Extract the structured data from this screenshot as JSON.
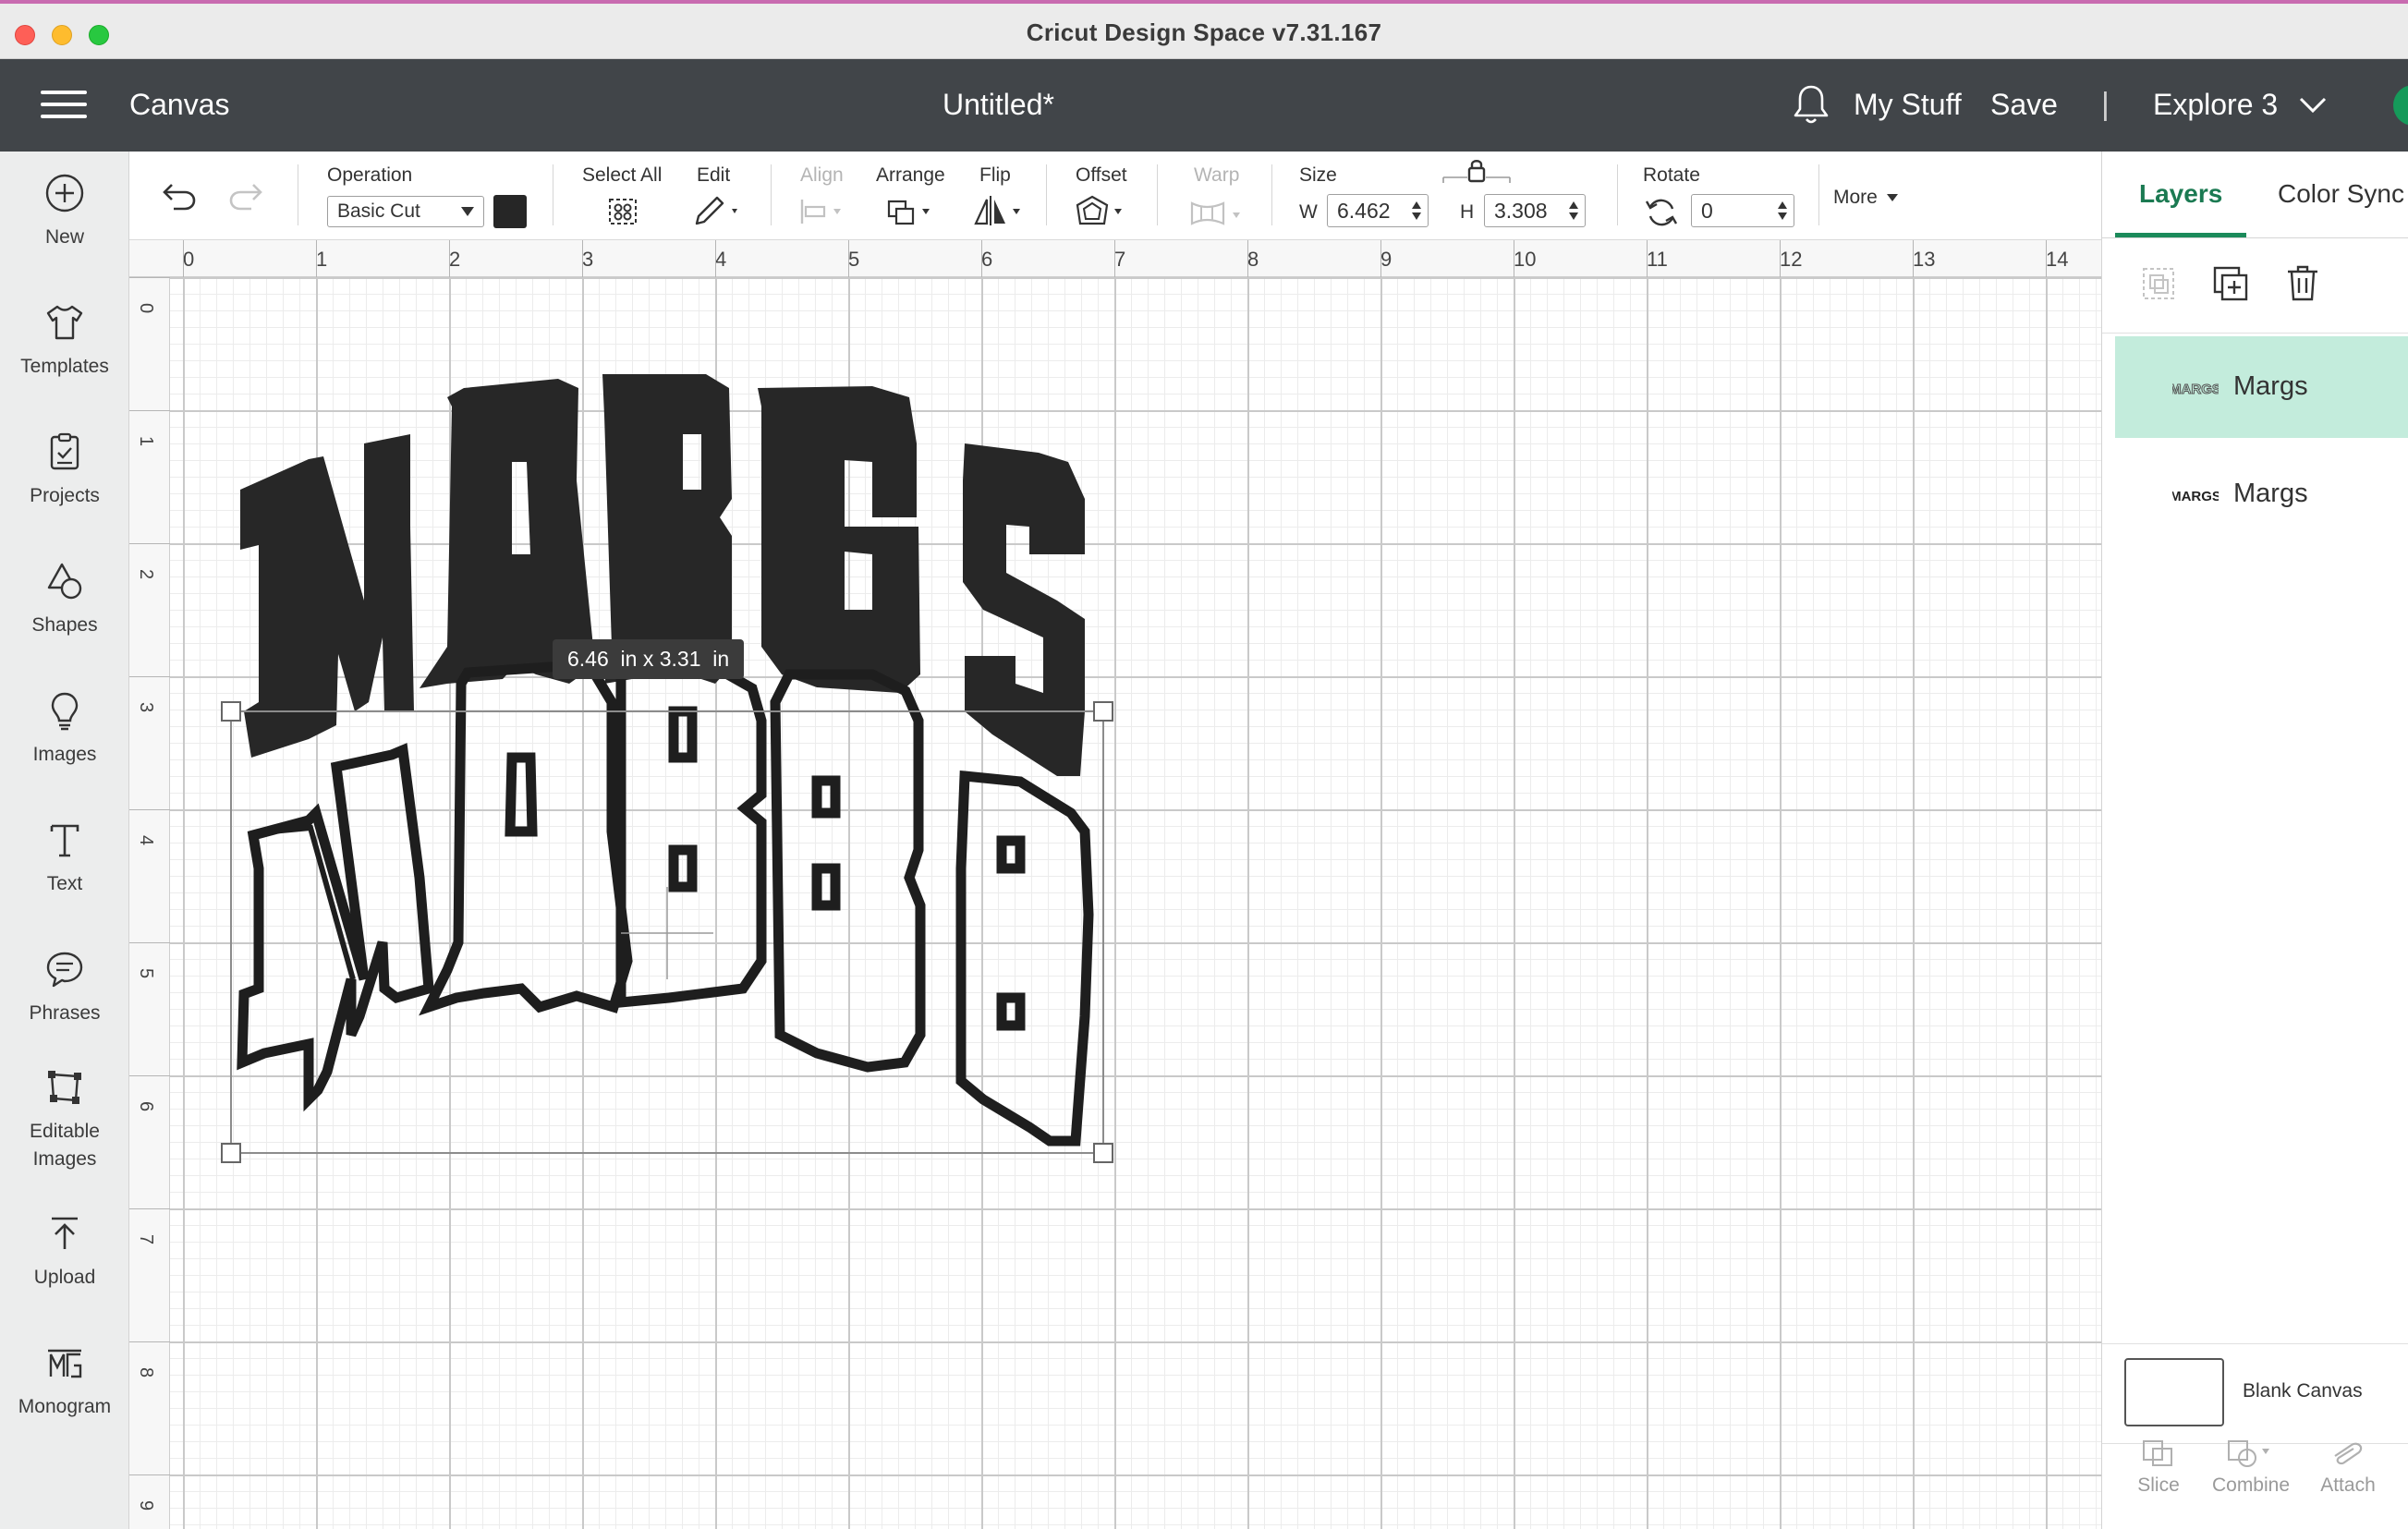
{
  "window": {
    "title": "Cricut Design Space  v7.31.167"
  },
  "header": {
    "canvas_label": "Canvas",
    "document_title": "Untitled*",
    "my_stuff": "My Stuff",
    "save": "Save",
    "separator": "|",
    "machine": "Explore 3",
    "icons": [
      "menu-icon",
      "bell-icon",
      "chevron-down-icon"
    ]
  },
  "sidebar": {
    "items": [
      {
        "label": "New",
        "icon": "plus-circle-icon"
      },
      {
        "label": "Templates",
        "icon": "tshirt-icon"
      },
      {
        "label": "Projects",
        "icon": "clipboard-icon"
      },
      {
        "label": "Shapes",
        "icon": "shapes-icon"
      },
      {
        "label": "Images",
        "icon": "lightbulb-icon"
      },
      {
        "label": "Text",
        "icon": "text-icon"
      },
      {
        "label": "Phrases",
        "icon": "speech-bubble-icon"
      },
      {
        "label": "Editable Images",
        "icon": "editable-images-icon"
      },
      {
        "label": "Upload",
        "icon": "upload-icon"
      },
      {
        "label": "Monogram",
        "icon": "monogram-icon"
      }
    ]
  },
  "toolbar": {
    "operation_label": "Operation",
    "operation_value": "Basic Cut",
    "select_all": "Select All",
    "edit": "Edit",
    "align": "Align",
    "arrange": "Arrange",
    "flip": "Flip",
    "offset": "Offset",
    "warp": "Warp",
    "size_label": "Size",
    "w_label": "W",
    "w_value": "6.462",
    "h_label": "H",
    "h_value": "3.308",
    "rotate_label": "Rotate",
    "rotate_value": "0",
    "more": "More",
    "swatch_color": "#262626"
  },
  "ruler": {
    "top": [
      "0",
      "1",
      "2",
      "3",
      "4",
      "5",
      "6",
      "7",
      "8",
      "9",
      "10",
      "11",
      "12",
      "13",
      "14"
    ],
    "left": [
      "0",
      "1",
      "2",
      "3",
      "4",
      "5",
      "6",
      "7",
      "8",
      "9"
    ]
  },
  "canvas": {
    "dimension_tooltip": "6.46  in x 3.31  in",
    "design_text": "MARGS"
  },
  "right_panel": {
    "tabs": [
      "Layers",
      "Color Sync"
    ],
    "active_tab": "Layers",
    "layers": [
      {
        "name": "Margs",
        "selected": true,
        "thumb": "MARGS"
      },
      {
        "name": "Margs",
        "selected": false,
        "thumb": "MARGS"
      }
    ],
    "blank_canvas": "Blank Canvas",
    "bottom_actions": [
      "Slice",
      "Combine",
      "Attach"
    ]
  },
  "colors": {
    "header": "#414549",
    "accent": "#1b8a5a",
    "selected_layer": "#c3ecdc"
  }
}
